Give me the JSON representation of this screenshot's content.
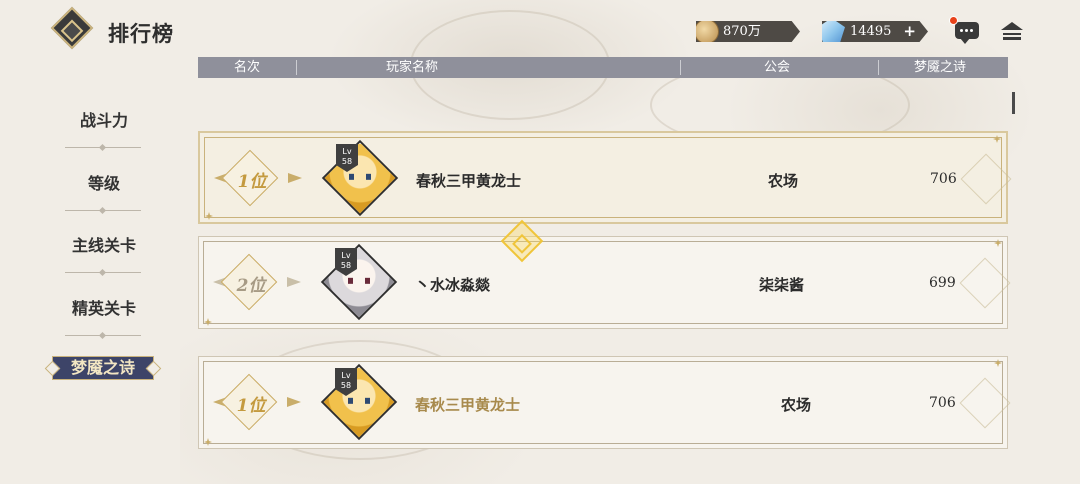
{
  "header": {
    "title": "排行榜",
    "coins": "870万",
    "gems": "14495",
    "gem_add": "+"
  },
  "columns": {
    "rank": "名次",
    "player": "玩家名称",
    "guild": "公会",
    "score": "梦魇之诗"
  },
  "sidebar": {
    "items": [
      {
        "label": "战斗力"
      },
      {
        "label": "等级"
      },
      {
        "label": "主线关卡"
      },
      {
        "label": "精英关卡"
      },
      {
        "label": "梦魇之诗"
      }
    ],
    "active_index": 4
  },
  "rows": [
    {
      "rank": "1位",
      "lv_prefix": "Lv",
      "level": "58",
      "name": "春秋三甲黄龙士",
      "guild": "农场",
      "score": "706",
      "avatar": "blonde-hero-avatar"
    },
    {
      "rank": "2位",
      "lv_prefix": "Lv",
      "level": "58",
      "name": "丶水冰淼燚",
      "guild": "柒柒酱",
      "score": "699",
      "avatar": "silver-hair-heroine-avatar"
    },
    {
      "rank": "1位",
      "lv_prefix": "Lv",
      "level": "58",
      "name": "春秋三甲黄龙士",
      "guild": "农场",
      "score": "706",
      "avatar": "blonde-hero-avatar"
    }
  ],
  "colors": {
    "column_header_bg": "#8f909b",
    "active_tab_bg": "#3d4468",
    "accent_gold": "#c9b27c",
    "notification_dot": "#e8421a"
  }
}
